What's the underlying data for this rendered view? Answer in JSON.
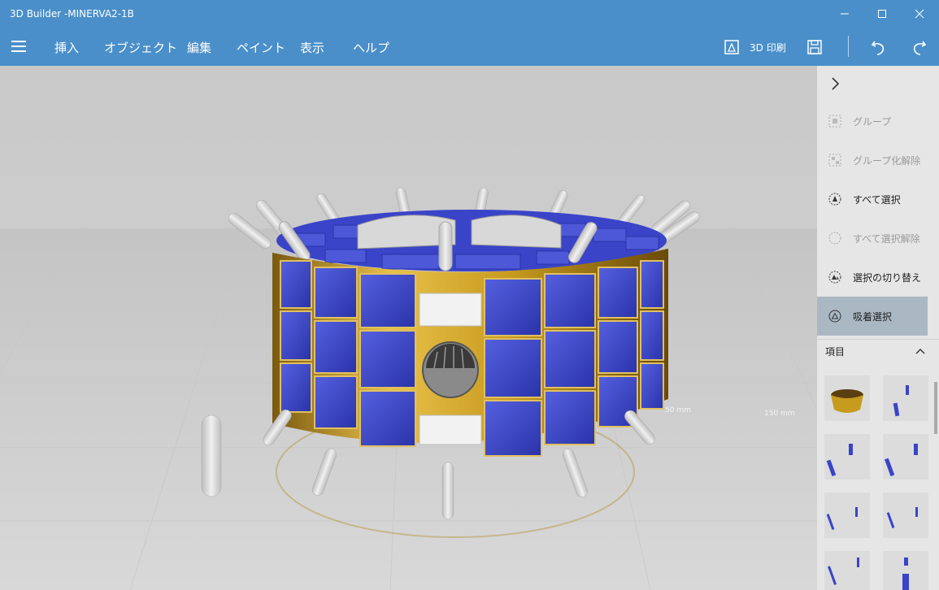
{
  "window": {
    "title": "3D Builder -MINERVA2-1B"
  },
  "menu": {
    "items": [
      "挿入",
      "オブジェクト",
      "編集",
      "ペイント",
      "表示",
      "ヘルプ"
    ]
  },
  "toolbar": {
    "print_label": "3D 印刷"
  },
  "viewport": {
    "scale_labels": [
      "50 mm",
      "150 mm"
    ]
  },
  "side_panel": {
    "actions": [
      {
        "label": "グループ",
        "icon": "group-icon",
        "enabled": false
      },
      {
        "label": "グループ化解除",
        "icon": "ungroup-icon",
        "enabled": false
      },
      {
        "label": "すべて選択",
        "icon": "select-all-icon",
        "enabled": true
      },
      {
        "label": "すべて選択解除",
        "icon": "deselect-all-icon",
        "enabled": false
      },
      {
        "label": "選択の切り替え",
        "icon": "toggle-selection-icon",
        "enabled": true
      },
      {
        "label": "吸着選択",
        "icon": "snap-select-icon",
        "enabled": true,
        "selected": true
      }
    ],
    "items_header": "項目"
  },
  "colors": {
    "accent": "#4a8fc9",
    "panel_solar": "#3a44c8",
    "gold_band": "#c79b1e"
  }
}
